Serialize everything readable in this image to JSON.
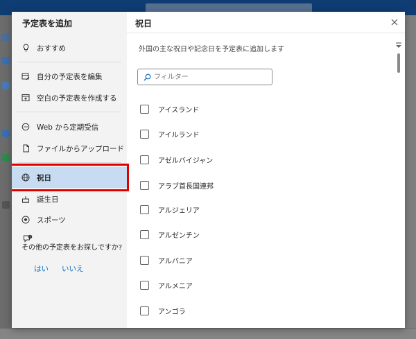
{
  "nav": {
    "title": "予定表を追加",
    "items": [
      {
        "label": "おすすめ",
        "icon": "lightbulb-icon"
      },
      {
        "label": "自分の予定表を編集",
        "icon": "calendar-edit-icon"
      },
      {
        "label": "空白の予定表を作成する",
        "icon": "calendar-add-icon"
      },
      {
        "label": "Web から定期受信",
        "icon": "web-subscribe-icon"
      },
      {
        "label": "ファイルからアップロード",
        "icon": "file-upload-icon"
      },
      {
        "label": "祝日",
        "icon": "globe-icon"
      },
      {
        "label": "誕生日",
        "icon": "cake-icon"
      },
      {
        "label": "スポーツ",
        "icon": "sports-icon"
      }
    ],
    "ask_text": "その他の予定表をお探しですか?",
    "yes_label": "はい",
    "no_label": "いいえ"
  },
  "content": {
    "title": "祝日",
    "description": "外国の主な祝日や記念日を予定表に追加します",
    "filter_placeholder": "フィルター",
    "countries": [
      "アイスランド",
      "アイルランド",
      "アゼルバイジャン",
      "アラブ首長国連邦",
      "アルジェリア",
      "アルゼンチン",
      "アルバニア",
      "アルメニア",
      "アンゴラ"
    ]
  },
  "colors": {
    "accent": "#0f6cbd",
    "selected_bg": "#c7dcf3",
    "highlight_border": "#e00000"
  }
}
